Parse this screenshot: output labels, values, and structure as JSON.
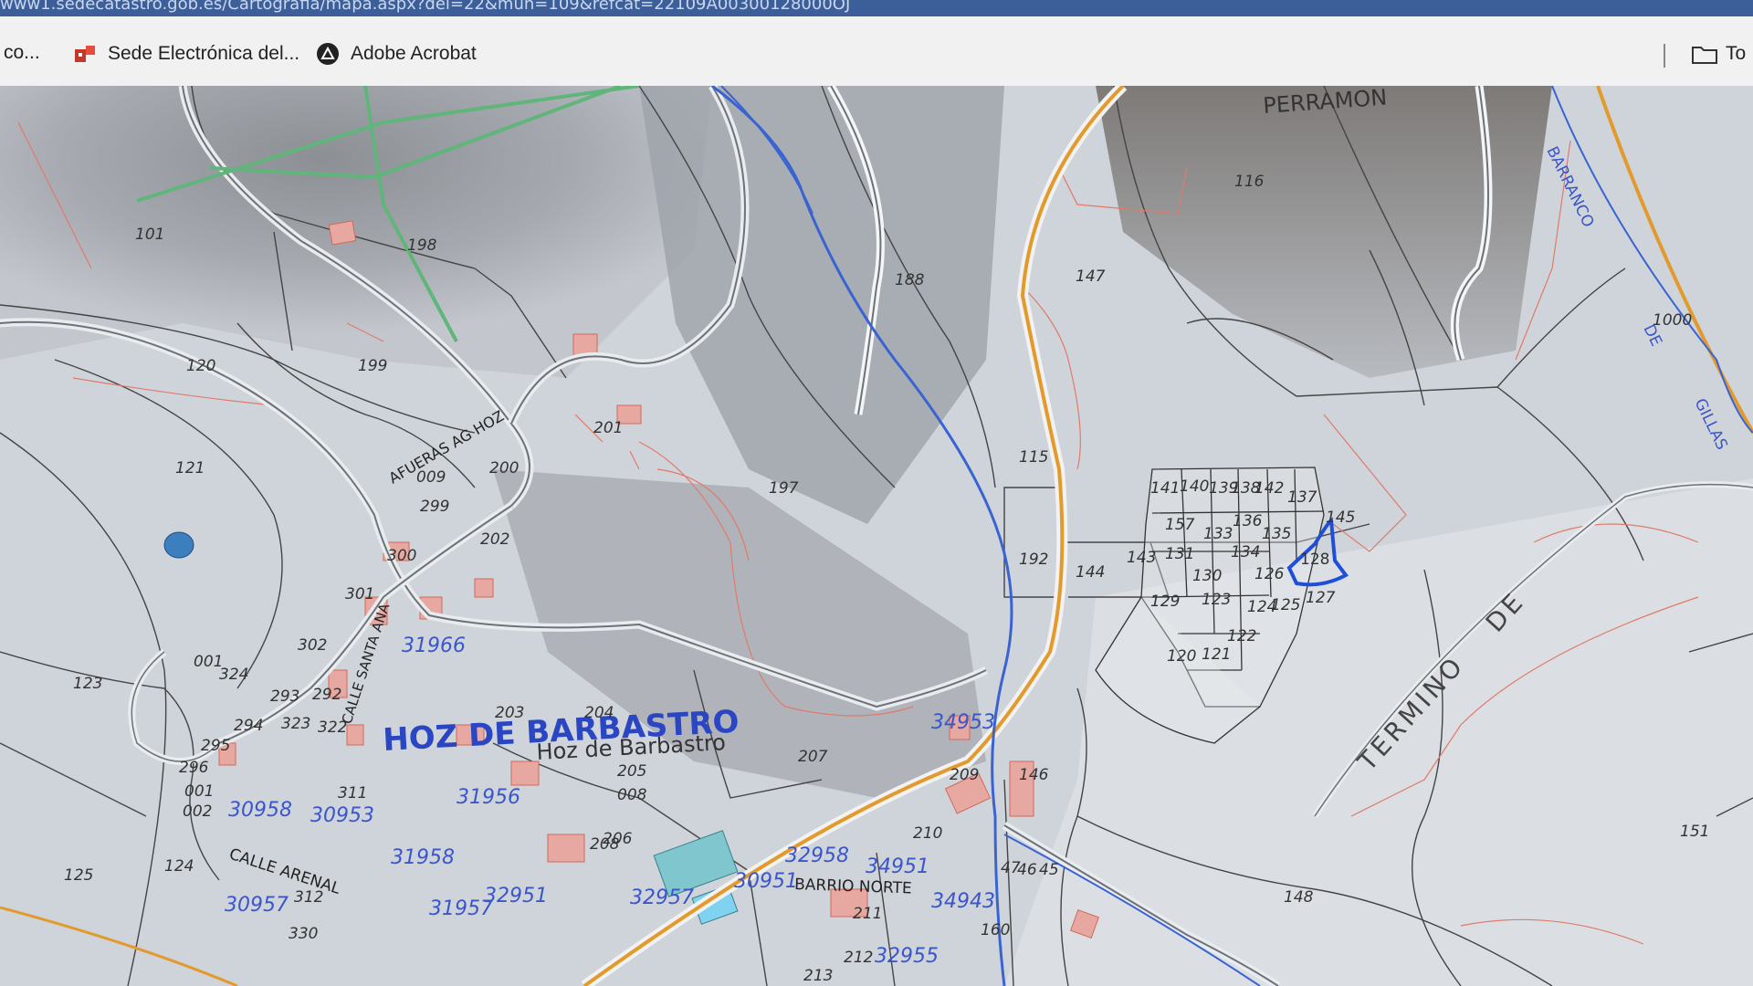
{
  "browser": {
    "url_text": "www1.sedecatastro.gob.es/Cartografia/mapa.aspx?del=22&mun=109&refcat=22109A00300128000OJ",
    "bookmarks": [
      {
        "label": "co..."
      },
      {
        "label": "Sede Electrónica del..."
      },
      {
        "label": "Adobe Acrobat"
      }
    ],
    "right_folder_label": "To"
  },
  "map": {
    "town_label": "HOZ DE BARBASTRO",
    "town_label_small": "Hoz de Barbastro",
    "place_label": "PERRAMON",
    "barranco_words": [
      "BARRANCO",
      "DE",
      "GILLAS"
    ],
    "termino_words": [
      "TERMINO",
      "DE"
    ],
    "road_label": "AFUERAS AG HOZ",
    "street_labels": [
      "CALLE SANTA ANA",
      "CALLE ARENAL",
      "BARRIO NORTE"
    ],
    "selected_parcel": "128",
    "parcel_labels": [
      "101",
      "198",
      "188",
      "147",
      "116",
      "1000",
      "120",
      "199",
      "201",
      "115",
      "197",
      "121",
      "009",
      "200",
      "299",
      "300",
      "202",
      "192",
      "144",
      "141",
      "140",
      "139",
      "138",
      "142",
      "137",
      "145",
      "157",
      "133",
      "136",
      "135",
      "143",
      "131",
      "134",
      "126",
      "130",
      "129",
      "123",
      "124",
      "125",
      "127",
      "122",
      "120",
      "121",
      "123",
      "001",
      "324",
      "301",
      "302",
      "293",
      "292",
      "294",
      "295",
      "296",
      "323",
      "322",
      "311",
      "203",
      "204",
      "205",
      "207",
      "206",
      "008",
      "209",
      "146",
      "210",
      "208",
      "151",
      "148",
      "125",
      "124",
      "312",
      "330",
      "211",
      "212",
      "213",
      "160",
      "47",
      "46",
      "45",
      "001",
      "002"
    ],
    "blue_ref_labels": [
      "31966",
      "34953",
      "30958",
      "31956",
      "31958",
      "32951",
      "32957",
      "30957",
      "31957",
      "30953",
      "34951",
      "34943",
      "30951",
      "32958",
      "32955"
    ]
  },
  "colors": {
    "selected_outline": "#1f4fd6",
    "river": "#3a63d2",
    "road_orange": "#e39a2c",
    "power_line": "#5fb57a",
    "parcel_line": "#4a4a4a",
    "subparcel_line": "#e07a6a",
    "blue_label": "#3b56c9"
  }
}
